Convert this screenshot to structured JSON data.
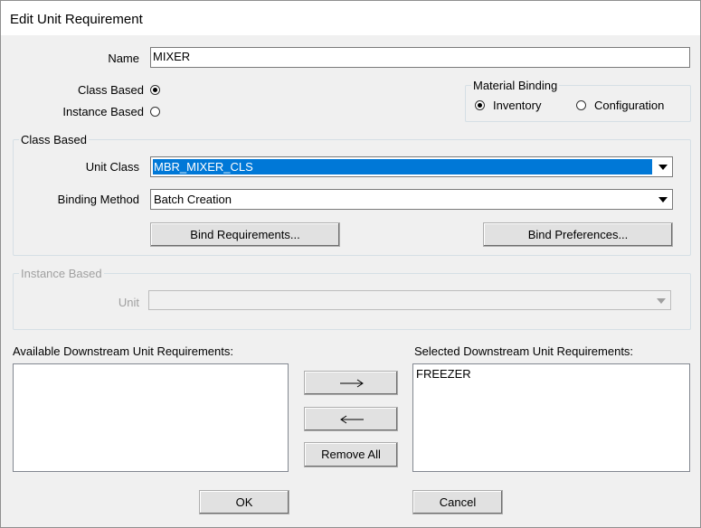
{
  "window": {
    "title": "Edit Unit Requirement"
  },
  "name_field": {
    "label": "Name",
    "value": "MIXER"
  },
  "mode": {
    "class_based_label": "Class Based",
    "instance_based_label": "Instance Based",
    "selected": "class_based"
  },
  "material_binding": {
    "title": "Material Binding",
    "inventory_label": "Inventory",
    "configuration_label": "Configuration",
    "selected": "inventory"
  },
  "class_group": {
    "title": "Class Based",
    "unit_class_label": "Unit Class",
    "unit_class_value": "MBR_MIXER_CLS",
    "binding_method_label": "Binding Method",
    "binding_method_value": "Batch Creation",
    "bind_requirements_label": "Bind Requirements...",
    "bind_preferences_label": "Bind Preferences..."
  },
  "instance_group": {
    "title": "Instance Based",
    "unit_label": "Unit",
    "unit_value": ""
  },
  "available_list": {
    "label": "Available Downstream Unit Requirements:",
    "items": []
  },
  "selected_list": {
    "label": "Selected Downstream Unit Requirements:",
    "items": [
      "FREEZER"
    ]
  },
  "transfer": {
    "add_glyph": "→",
    "remove_glyph": "←",
    "remove_all_label": "Remove All"
  },
  "footer": {
    "ok_label": "OK",
    "cancel_label": "Cancel"
  }
}
